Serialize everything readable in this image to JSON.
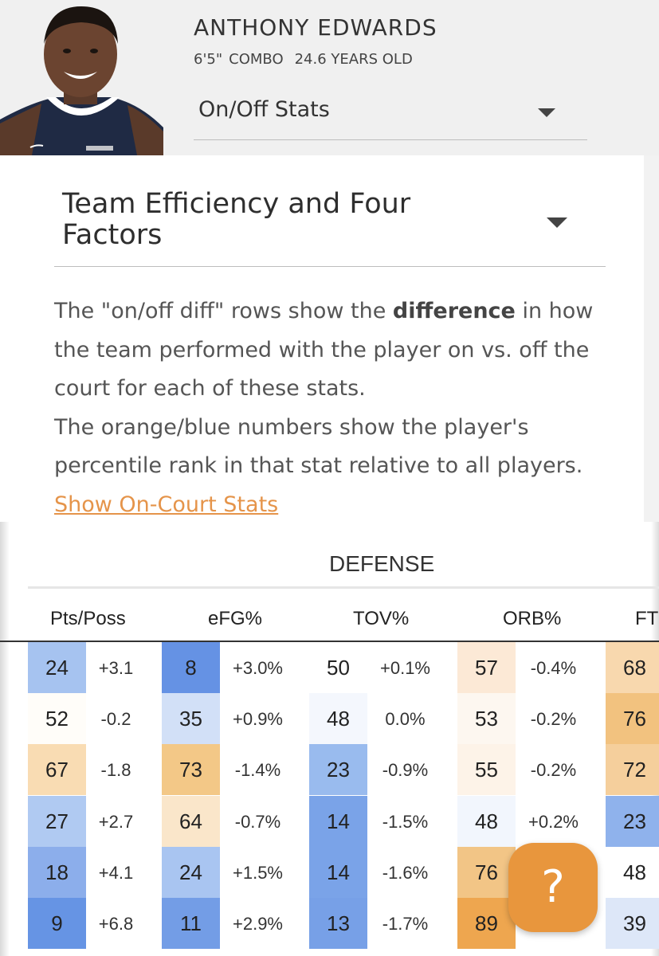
{
  "player": {
    "name": "ANTHONY EDWARDS",
    "height": "6'5\"",
    "position": "COMBO",
    "age": "24.6 YEARS OLD"
  },
  "view_select": {
    "selected": "On/Off Stats"
  },
  "stat_select": {
    "selected": "Team Efficiency and Four Factors"
  },
  "description": {
    "p1_before": "The \"on/off diff\" rows show the ",
    "p1_bold": "difference",
    "p1_after": " in how the team performed with the player on vs. off the court for each of these stats.",
    "p2": "The orange/blue numbers show the player's percentile rank in that stat relative to all players.",
    "link": "Show On-Court Stats"
  },
  "table": {
    "section_title": "DEFENSE",
    "columns": [
      "Pts/Poss",
      "eFG%",
      "TOV%",
      "ORB%",
      "FT"
    ],
    "rows": [
      {
        "cells": [
          {
            "rank": "24",
            "diff": "+3.1",
            "color": "#a6c3f0"
          },
          {
            "rank": "8",
            "diff": "+3.0%",
            "color": "#6592e4"
          },
          {
            "rank": "50",
            "diff": "+0.1%",
            "color": "#ffffff"
          },
          {
            "rank": "57",
            "diff": "-0.4%",
            "color": "#fce9d6"
          },
          {
            "rank": "68",
            "diff": "",
            "color": "#f8d8ae"
          }
        ]
      },
      {
        "cells": [
          {
            "rank": "52",
            "diff": "-0.2",
            "color": "#fffdf9"
          },
          {
            "rank": "35",
            "diff": "+0.9%",
            "color": "#d2e0f7"
          },
          {
            "rank": "48",
            "diff": "0.0%",
            "color": "#f4f7fd"
          },
          {
            "rank": "53",
            "diff": "-0.2%",
            "color": "#fdf7f0"
          },
          {
            "rank": "76",
            "diff": "",
            "color": "#f2c27f"
          }
        ]
      },
      {
        "cells": [
          {
            "rank": "67",
            "diff": "-1.8",
            "color": "#f9dcb3"
          },
          {
            "rank": "73",
            "diff": "-1.4%",
            "color": "#f3c887"
          },
          {
            "rank": "23",
            "diff": "-0.9%",
            "color": "#99bbee"
          },
          {
            "rank": "55",
            "diff": "-0.2%",
            "color": "#fdf3e8"
          },
          {
            "rank": "72",
            "diff": "",
            "color": "#f5cf9c"
          }
        ]
      },
      {
        "cells": [
          {
            "rank": "27",
            "diff": "+2.7",
            "color": "#b0caf2"
          },
          {
            "rank": "64",
            "diff": "-0.7%",
            "color": "#fae6ca"
          },
          {
            "rank": "14",
            "diff": "-1.5%",
            "color": "#7aa3e8"
          },
          {
            "rank": "48",
            "diff": "+0.2%",
            "color": "#f2f6fd"
          },
          {
            "rank": "23",
            "diff": "",
            "color": "#8fb2ec"
          }
        ]
      },
      {
        "cells": [
          {
            "rank": "18",
            "diff": "+4.1",
            "color": "#8caeeb"
          },
          {
            "rank": "24",
            "diff": "+1.5%",
            "color": "#a9c5f1"
          },
          {
            "rank": "14",
            "diff": "-1.6%",
            "color": "#7aa3e8"
          },
          {
            "rank": "76",
            "diff": "",
            "color": "#f2c586"
          },
          {
            "rank": "48",
            "diff": "",
            "color": "#ffffff"
          }
        ]
      },
      {
        "cells": [
          {
            "rank": "9",
            "diff": "+6.8",
            "color": "#6694e4"
          },
          {
            "rank": "11",
            "diff": "+2.9%",
            "color": "#739de6"
          },
          {
            "rank": "13",
            "diff": "-1.7%",
            "color": "#77a0e7"
          },
          {
            "rank": "89",
            "diff": "",
            "color": "#eea64f"
          },
          {
            "rank": "39",
            "diff": "",
            "color": "#dde7f8"
          }
        ]
      }
    ]
  },
  "help_button": {
    "label": "?"
  },
  "colors": {
    "accent": "#e8963d",
    "link": "#e5944a"
  }
}
